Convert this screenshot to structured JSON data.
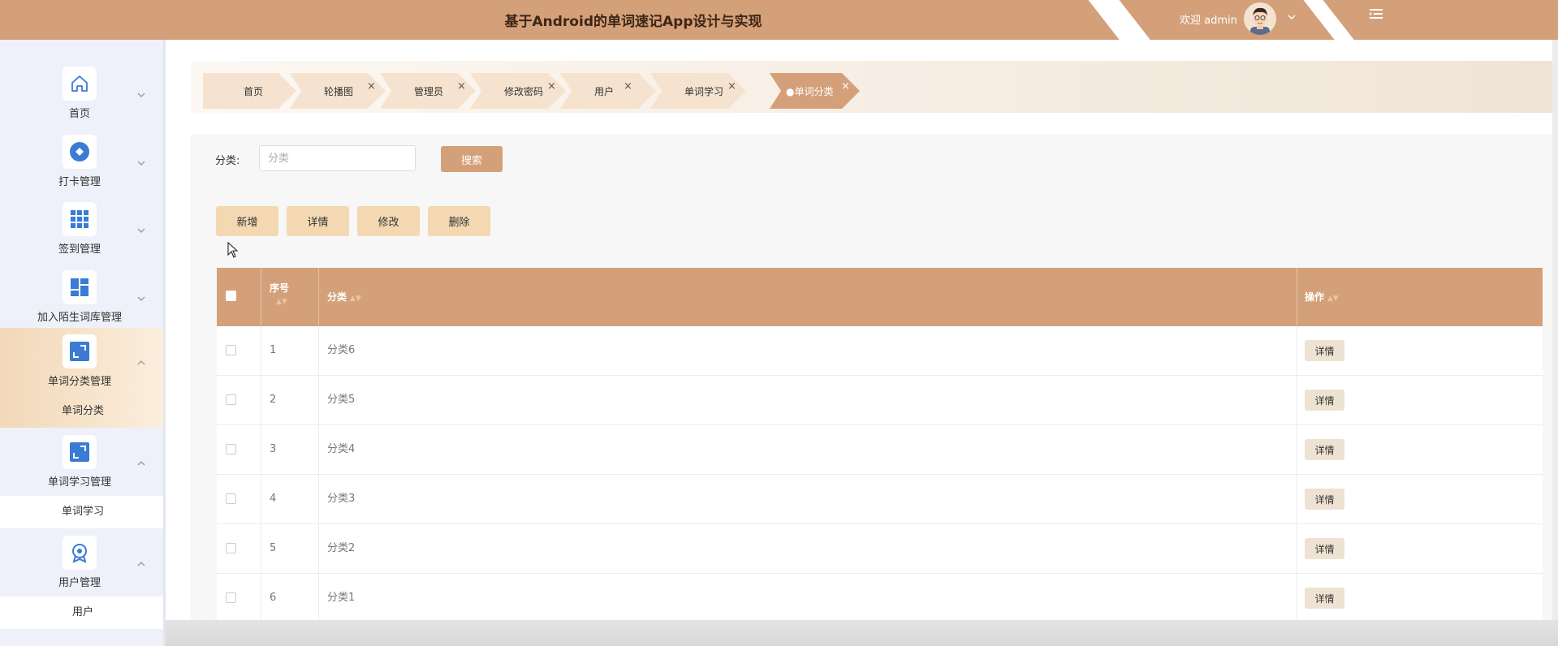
{
  "header": {
    "title": "基于Android的单词速记App设计与实现",
    "welcome": "欢迎 admin",
    "colors": {
      "bar": "#d4a07a",
      "text": "#3d2614"
    }
  },
  "sidebar": {
    "items": [
      {
        "label": "首页",
        "icon": "home-icon"
      },
      {
        "label": "打卡管理",
        "icon": "diamond-circle-icon"
      },
      {
        "label": "签到管理",
        "icon": "grid-icon"
      },
      {
        "label": "加入陌生词库管理",
        "icon": "dashboard-icon"
      },
      {
        "label": "单词分类管理",
        "icon": "expand-icon",
        "sub": "单词分类"
      },
      {
        "label": "单词学习管理",
        "icon": "expand-icon",
        "sub": "单词学习"
      },
      {
        "label": "用户管理",
        "icon": "award-icon",
        "sub": "用户"
      }
    ]
  },
  "tabs": [
    {
      "label": "首页",
      "closable": false
    },
    {
      "label": "轮播图",
      "closable": true
    },
    {
      "label": "管理员",
      "closable": true
    },
    {
      "label": "修改密码",
      "closable": true
    },
    {
      "label": "用户",
      "closable": true
    },
    {
      "label": "单词学习",
      "closable": true
    },
    {
      "label": "●单词分类",
      "closable": true,
      "active": true
    }
  ],
  "tab_close_glyph": "×",
  "search": {
    "label": "分类:",
    "placeholder": "分类",
    "button": "搜索"
  },
  "actions": {
    "add": "新增",
    "detail": "详情",
    "edit": "修改",
    "delete": "删除"
  },
  "table": {
    "columns": {
      "index": "序号",
      "category": "分类",
      "operation": "操作"
    },
    "rows": [
      {
        "index": "1",
        "category": "分类6",
        "action": "详情"
      },
      {
        "index": "2",
        "category": "分类5",
        "action": "详情"
      },
      {
        "index": "3",
        "category": "分类4",
        "action": "详情"
      },
      {
        "index": "4",
        "category": "分类3",
        "action": "详情"
      },
      {
        "index": "5",
        "category": "分类2",
        "action": "详情"
      },
      {
        "index": "6",
        "category": "分类1",
        "action": "详情"
      }
    ]
  },
  "accent_color": "#d4a07a",
  "button_color": "#f3d8b1"
}
